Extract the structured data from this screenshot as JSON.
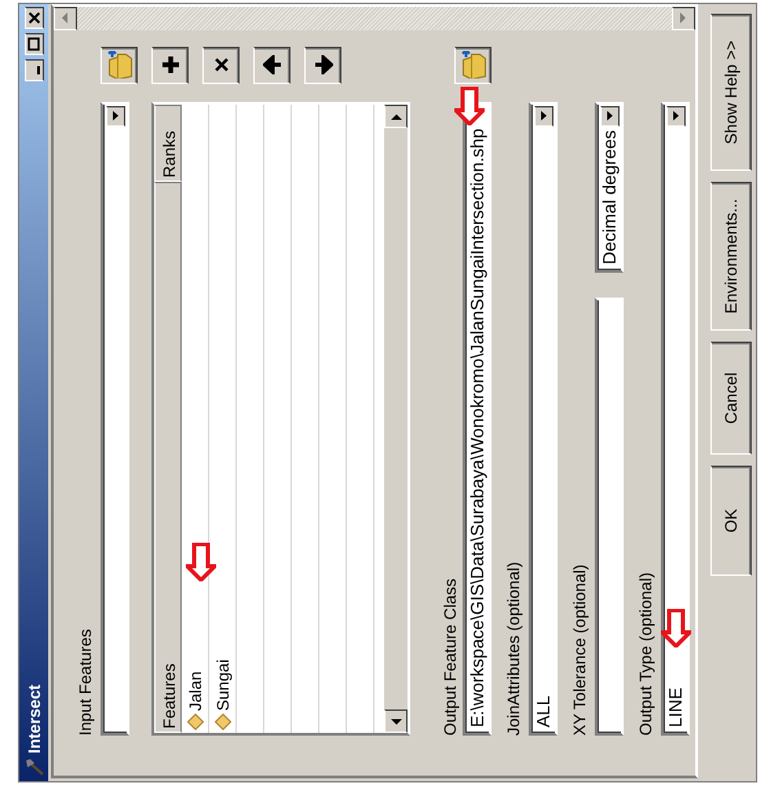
{
  "window": {
    "title": "Intersect"
  },
  "input_features": {
    "label": "Input Features"
  },
  "features_table": {
    "columns": [
      "Features",
      "Ranks"
    ],
    "rows": [
      {
        "name": "Jalan"
      },
      {
        "name": "Sungai"
      }
    ]
  },
  "output_feature_class": {
    "label": "Output Feature Class",
    "value": "E:\\workspace\\GIS\\Data\\Surabaya\\Wonokromo\\JalanSungaiIntersection.shp"
  },
  "join_attributes": {
    "label": "JoinAttributes (optional)",
    "value": "ALL"
  },
  "xy_tolerance": {
    "label": "XY Tolerance (optional)",
    "units": "Decimal degrees"
  },
  "output_type": {
    "label": "Output Type (optional)",
    "value": "LINE"
  },
  "buttons": [
    "OK",
    "Cancel",
    "Environments...",
    "Show Help >>"
  ]
}
